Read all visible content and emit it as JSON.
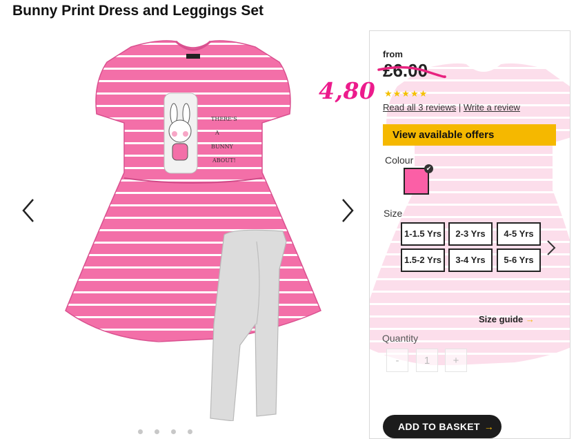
{
  "product": {
    "title": "Bunny Print Dress and Leggings Set"
  },
  "price": {
    "from_label": "from",
    "amount": "£6.00",
    "handwritten_price": "4,80"
  },
  "rating": {
    "stars": 5,
    "stars_glyphs": "★★★★★",
    "read_reviews": "Read all 3 reviews",
    "separator": " | ",
    "write_review": "Write a review"
  },
  "offers": {
    "label": "View available offers"
  },
  "colour": {
    "label": "Colour",
    "selected_hex": "#fb5fa6"
  },
  "size": {
    "label": "Size",
    "options": [
      "1-1.5 Yrs",
      "2-3 Yrs",
      "4-5 Yrs",
      "1.5-2 Yrs",
      "3-4 Yrs",
      "5-6 Yrs"
    ],
    "guide_label": "Size guide",
    "guide_arrow": "→"
  },
  "quantity": {
    "label": "Quantity",
    "minus": "-",
    "value": "1",
    "plus": "+"
  },
  "basket": {
    "label": "ADD TO BASKET",
    "arrow": "→"
  },
  "gallery": {
    "icons": [
      "chevron-left-icon",
      "chevron-right-icon"
    ],
    "dress_graphic_text": "THERE'S A BUNNY ABOUT!"
  },
  "colors": {
    "accent": "#f5b800",
    "brand_pink": "#ec1b8c",
    "dress_pink": "#f36fa8",
    "button_dark": "#1c1c1c"
  }
}
